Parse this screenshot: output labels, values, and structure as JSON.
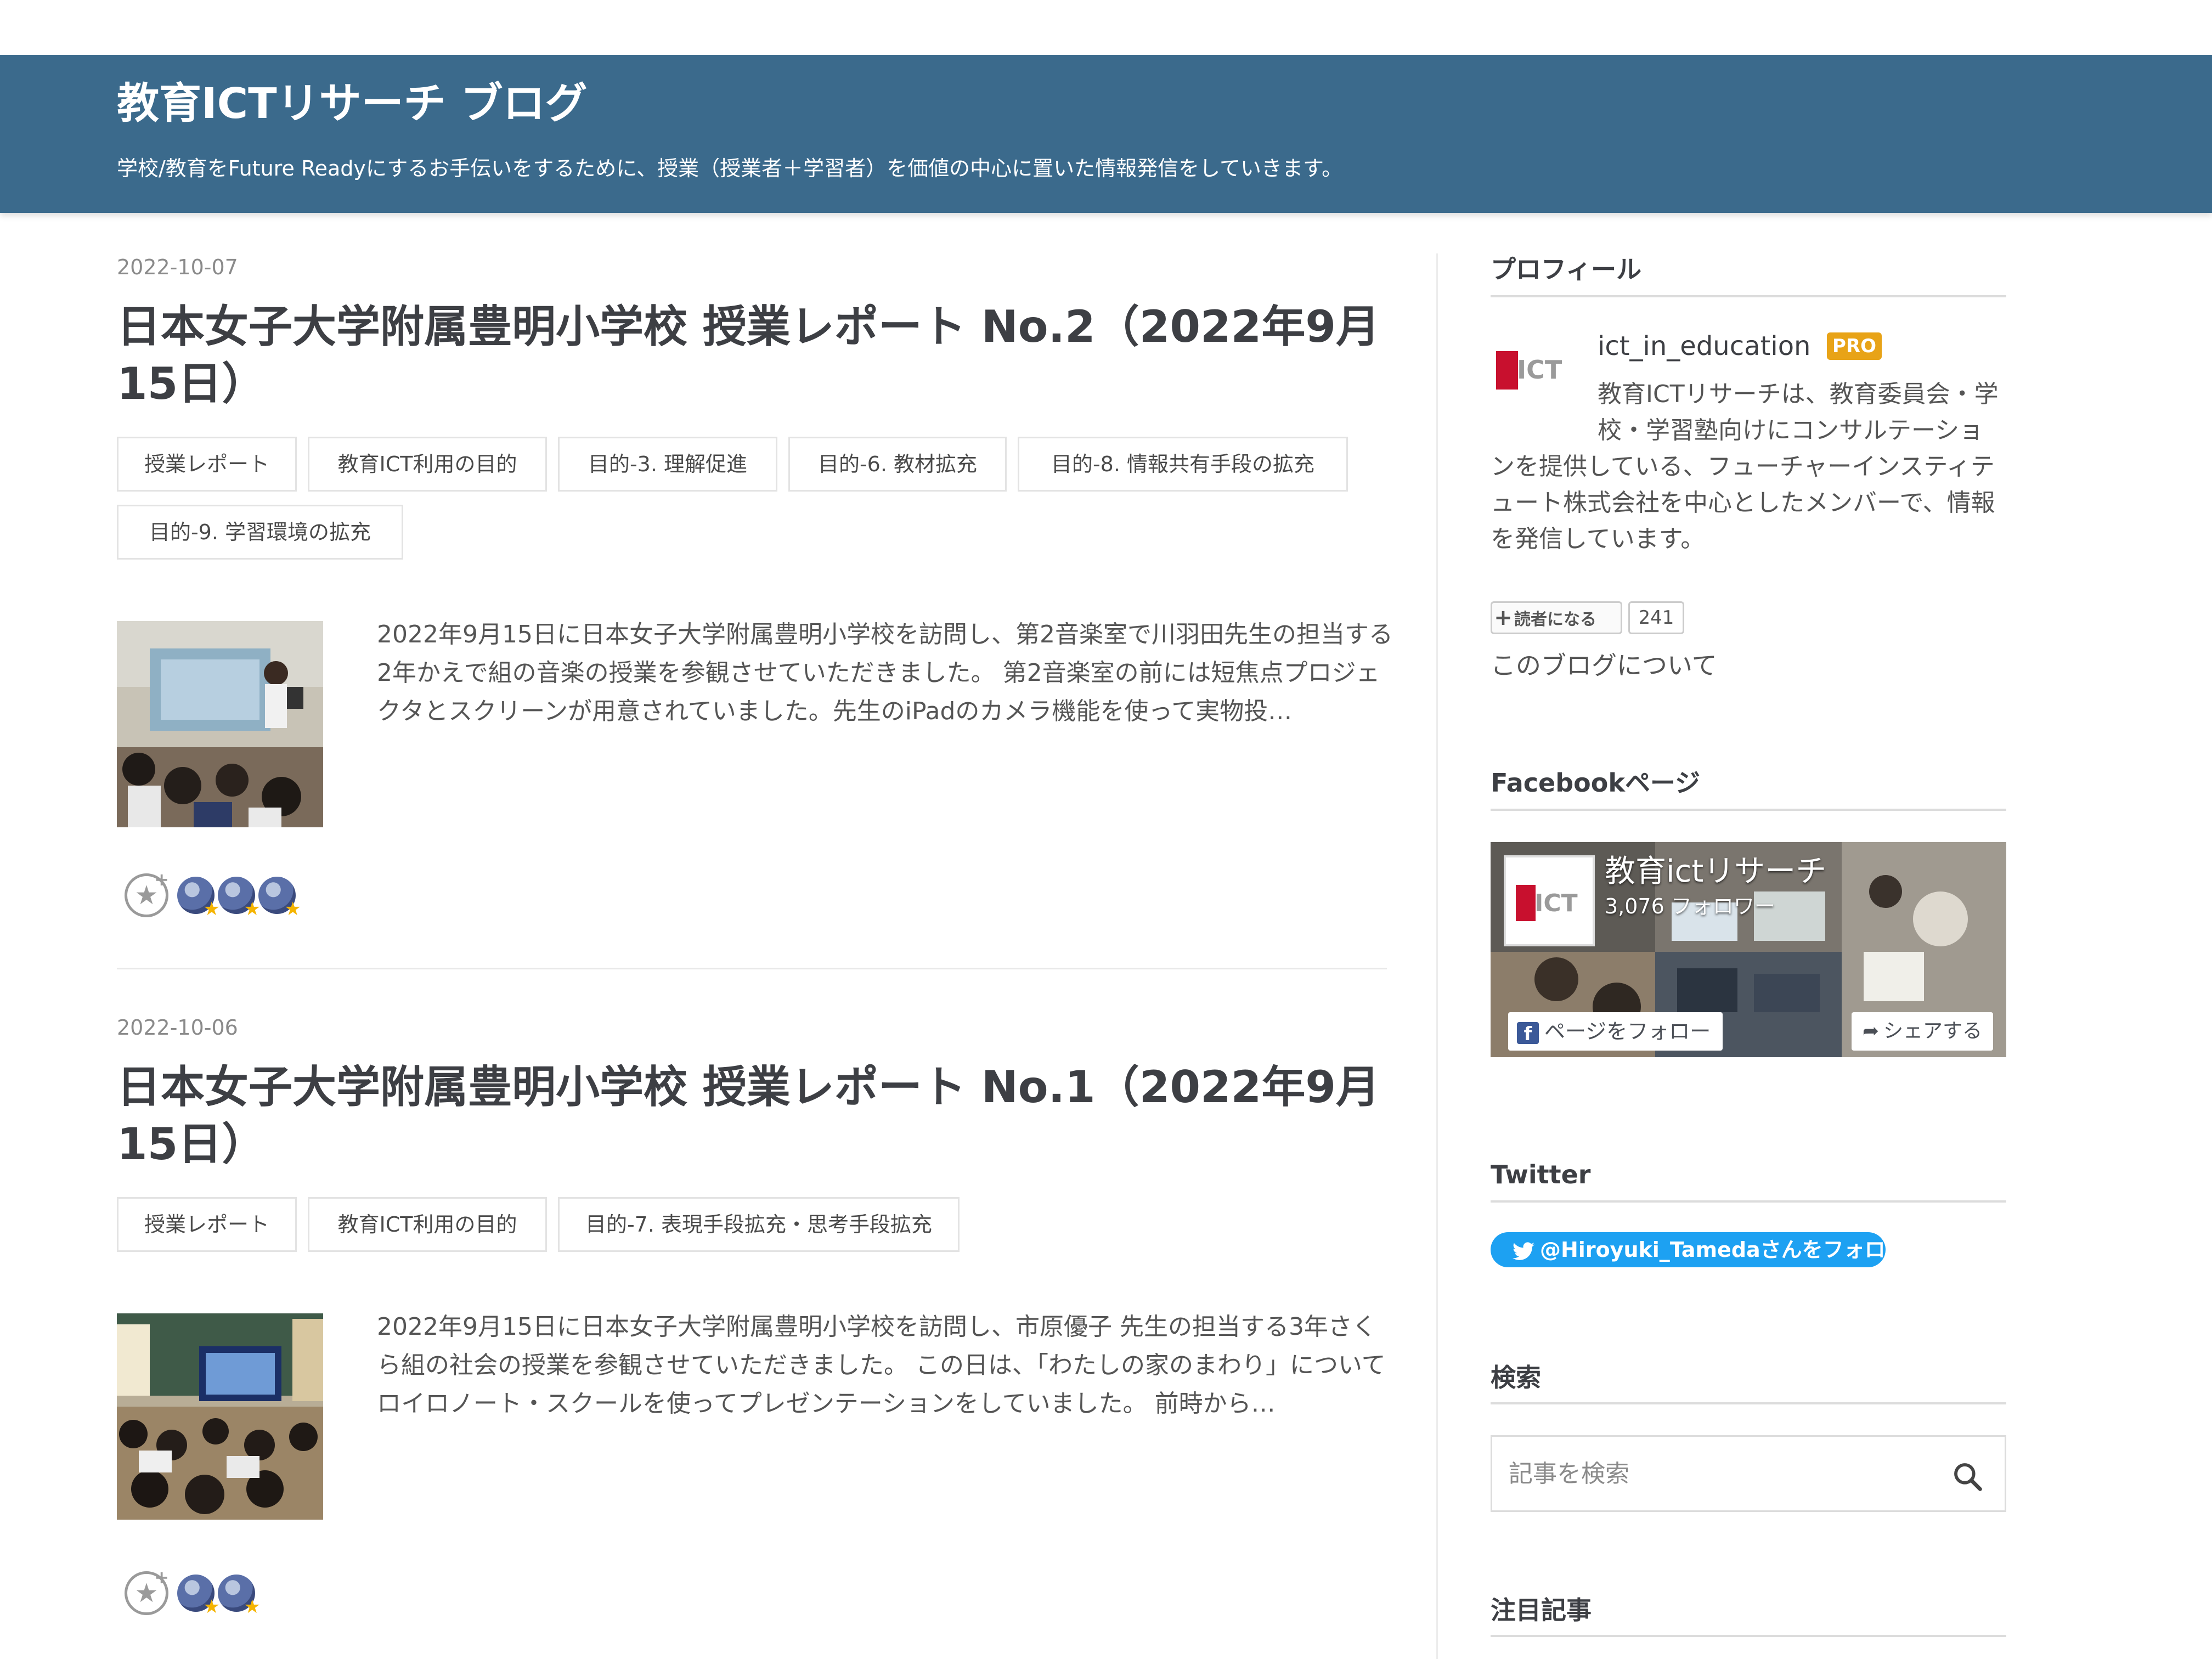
{
  "header": {
    "title": "教育ICTリサーチ ブログ",
    "description": "学校/教育をFuture Readyにするお手伝いをするために、授業（授業者＋学習者）を価値の中心に置いた情報発信をしていきます。"
  },
  "entries": [
    {
      "date": "2022-10-07",
      "title": "日本女子大学附属豊明小学校 授業レポート No.2（2022年9月15日）",
      "categories": [
        "授業レポート",
        "教育ICT利用の目的",
        "目的-3. 理解促進",
        "目的-6. 教材拡充",
        "目的-8. 情報共有手段の拡充",
        "目的-9. 学習環境の拡充"
      ],
      "summary": "2022年9月15日に日本女子大学附属豊明小学校を訪問し、第2音楽室で川羽田先生の担当する2年かえで組の音楽の授業を参観させていただきました。 第2音楽室の前には短焦点プロジェクタとスクリーンが用意されていました。先生のiPadのカメラ機能を使って実物投…",
      "star_add_icon": "add-star-icon",
      "star_count": 3
    },
    {
      "date": "2022-10-06",
      "title": "日本女子大学附属豊明小学校 授業レポート No.1（2022年9月15日）",
      "categories": [
        "授業レポート",
        "教育ICT利用の目的",
        "目的-7. 表現手段拡充・思考手段拡充"
      ],
      "summary": "2022年9月15日に日本女子大学附属豊明小学校を訪問し、市原優子 先生の担当する3年さくら組の社会の授業を参観させていただきました。 この日は、「わたしの家のまわり」についてロイロノート・スクールを使ってプレゼンテーションをしていました。 前時から…",
      "star_add_icon": "add-star-icon",
      "star_count": 2
    }
  ],
  "sidebar": {
    "profile": {
      "heading": "プロフィール",
      "name": "ict_in_education",
      "badge": "PRO",
      "desc_top": "教育ICTリサーチは、教育委員会・学校・学習塾向けにコンサルテーショ",
      "desc_bottom": "ンを提供している、フューチャーインスティテュート株式会社を中心としたメンバーで、情報を発信しています。",
      "subscribe_label": "読者になる",
      "subscriber_count": "241",
      "about_link": "このブログについて",
      "logo_text": "ICT"
    },
    "facebook": {
      "heading": "Facebookページ",
      "page_name": "教育ictリサーチ",
      "followers": "3,076 フォロワー",
      "follow_label": "ページをフォロー",
      "share_label": "シェアする",
      "logo_text": "ICT"
    },
    "twitter": {
      "heading": "Twitter",
      "follow_label": "@Hiroyuki_Tamedaさんをフォロー"
    },
    "search": {
      "heading": "検索",
      "placeholder": "記事を検索"
    },
    "featured": {
      "heading": "注目記事"
    }
  },
  "colors": {
    "header_bg": "#3b6a8c",
    "pro_badge": "#e8a317",
    "twitter_blue": "#1da1f2",
    "logo_red": "#c8102e"
  }
}
